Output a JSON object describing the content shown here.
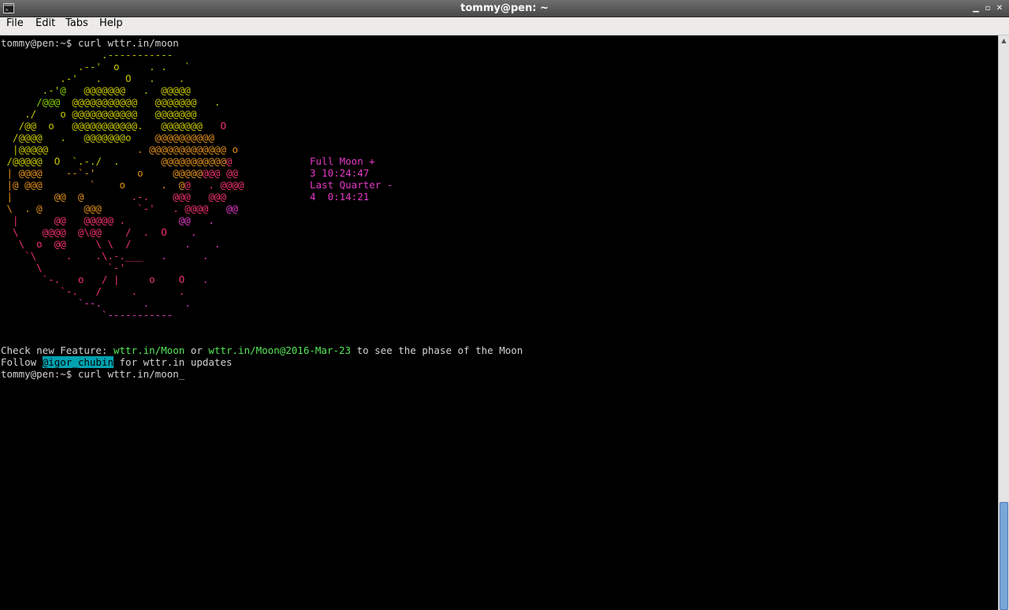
{
  "window": {
    "title": "tommy@pen: ~"
  },
  "menu": [
    "File",
    "Edit",
    "Tabs",
    "Help"
  ],
  "prompt": "tommy@pen:~$ ",
  "command": "curl wttr.in/moon",
  "moon_phase": {
    "line1": "Full Moon +",
    "line2": "3 10:24:47",
    "line3": "Last Quarter -",
    "line4": "4  0:14:21"
  },
  "footer": {
    "feature_prefix": "Check new Feature: ",
    "link1": "wttr.in/Moon",
    "or": " or ",
    "link2": "wttr.in/Moon@2016-Mar-23",
    "feature_suffix": " to see the phase of the Moon",
    "follow_prefix": "Follow ",
    "handle": "@igor_chubin",
    "follow_suffix": " for wttr.in updates"
  },
  "colors": {
    "terminal_bg": "#000000",
    "terminal_fg": "#d3d3d3",
    "yellow": "#c8c800",
    "green": "#88d100",
    "orange": "#e0901a",
    "red": "#f0336a",
    "magenta": "#e53ac8",
    "link": "#57e65a",
    "highlight": "#00a2b0"
  },
  "art": [
    [
      [
        "y",
        "                 .-----------"
      ]
    ],
    [
      [
        "y",
        "             .--'  o     . .   `"
      ]
    ],
    [
      [
        "y",
        "          .-'   .    O   .    ."
      ]
    ],
    [
      [
        "y",
        "       .-'"
      ],
      [
        "g",
        "@"
      ],
      [
        "y",
        "   @@@@@@@   .  @@@@@"
      ]
    ],
    [
      [
        "y",
        "      "
      ],
      [
        "g",
        "/@@@"
      ],
      [
        "y",
        "  @@@@@@@@@@@   @@@@@@@   ."
      ]
    ],
    [
      [
        "y",
        "    ./    o @@@@@@@@@@@   @@@@@@@"
      ]
    ],
    [
      [
        "y",
        "   /@@  o   @@@@@@@@@@@.   @@@@@@@   "
      ],
      [
        "r",
        "O"
      ]
    ],
    [
      [
        "y",
        "  /@@@@   .   @@@@@@@o    "
      ],
      [
        "o",
        "@@@@@@@@@@"
      ]
    ],
    [
      [
        "y",
        "  |@@@@@               "
      ],
      [
        "o",
        ". @@@@@@@@@@@@@ o"
      ]
    ],
    [
      [
        "y",
        " /@@@@@  O  `.-./  .       "
      ],
      [
        "o",
        "@@@@@@@@@@@"
      ],
      [
        "r",
        "@"
      ]
    ],
    [
      [
        "o",
        " | @@@@    --`-'       o     @@@@@"
      ],
      [
        "r",
        "@@@ @@"
      ]
    ],
    [
      [
        "o",
        " |@ @@@        `    o      .  @"
      ],
      [
        "r",
        "@   . @@@@"
      ]
    ],
    [
      [
        "o",
        " |       @@  @        "
      ],
      [
        "r",
        ".-.    @@@   @@@"
      ]
    ],
    [
      [
        "o",
        " \\  . @       @@@      "
      ],
      [
        "r",
        "`-'   . @@@@   "
      ],
      [
        "m",
        "@@"
      ]
    ],
    [
      [
        "r",
        "  |      @@   @@@@@ .         "
      ],
      [
        "m",
        "@@   ."
      ]
    ],
    [
      [
        "r",
        "  \\    @@@@  @\\@@    /  .  O    "
      ],
      [
        "m",
        "."
      ]
    ],
    [
      [
        "r",
        "   \\  o  @@     \\ \\  /      "
      ],
      [
        "m",
        "   .    ."
      ]
    ],
    [
      [
        "r",
        "    `\\     .    .\\.-.___"
      ],
      [
        "m",
        "   .      ."
      ]
    ],
    [
      [
        "r",
        "      \\           `-'"
      ]
    ],
    [
      [
        "r",
        "       `-.   o   / |     o    O   "
      ],
      [
        "m",
        "."
      ]
    ],
    [
      [
        "r",
        "          `-.   /     .       ."
      ]
    ],
    [
      [
        "m",
        "             `--.       .      ."
      ]
    ],
    [
      [
        "m",
        "                 `-----------"
      ]
    ]
  ]
}
